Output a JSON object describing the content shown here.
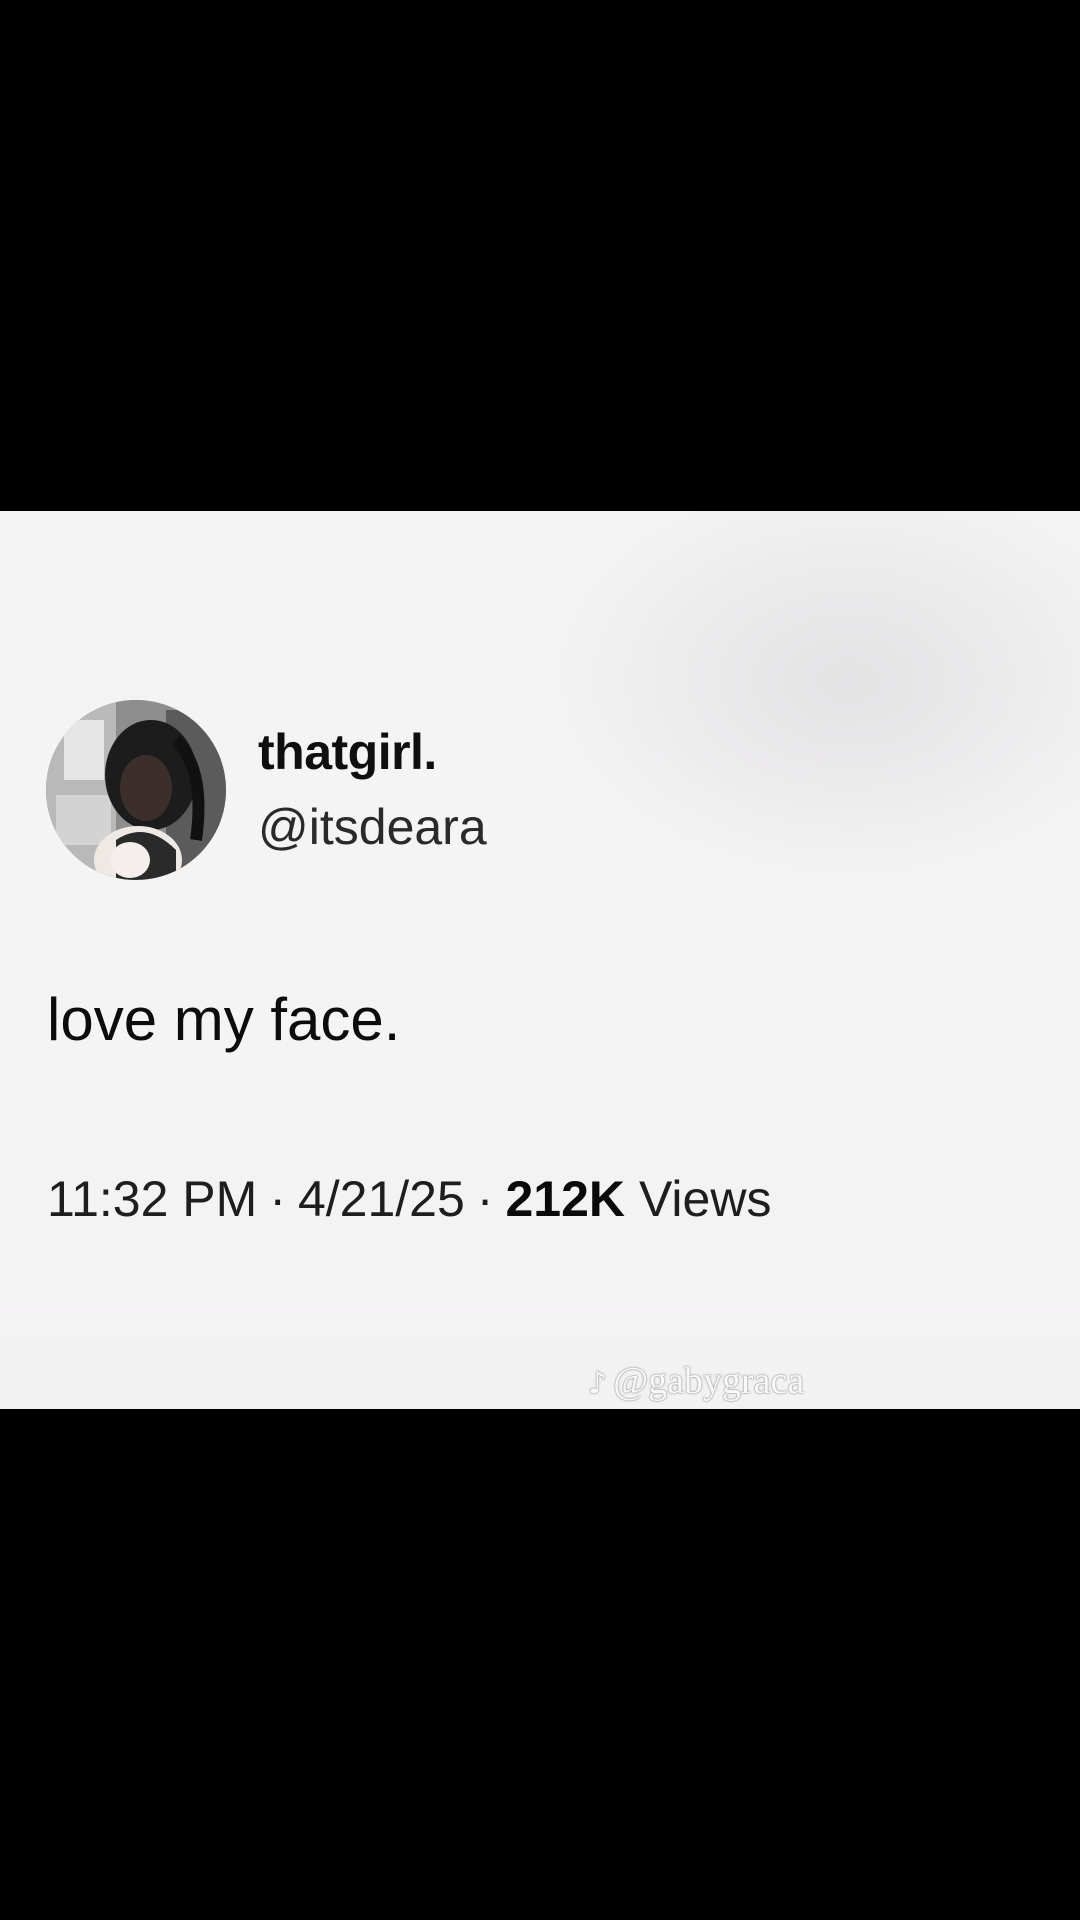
{
  "tweet": {
    "display_name": "thatgirl.",
    "handle": "@itsdeara",
    "text": "love my face.",
    "time": "11:32 PM",
    "separator": "·",
    "date": "4/21/25",
    "views_count": "212K",
    "views_label": "Views"
  },
  "watermark": {
    "icon": "tiktok-icon",
    "username": "@gabygraca"
  },
  "colors": {
    "card_background": "#f4f3f4",
    "letterbox": "#000000",
    "text_primary": "#0f0f0f"
  }
}
